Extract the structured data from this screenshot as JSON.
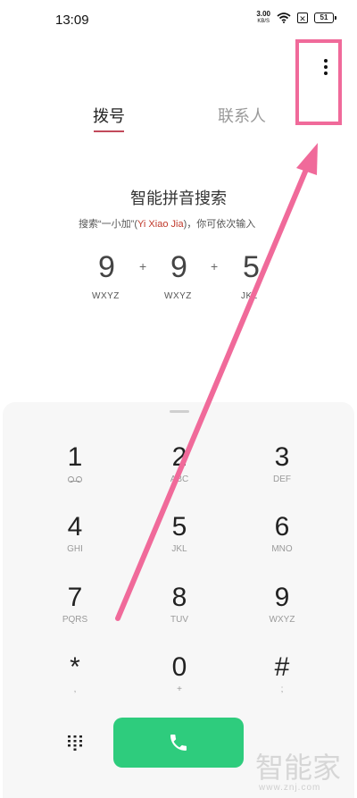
{
  "status_bar": {
    "time": "13:09",
    "net_speed_value": "3.00",
    "net_speed_unit": "KB/S",
    "sim_icon": "x-box-icon",
    "battery": "51"
  },
  "tabs": [
    {
      "label": "拨号",
      "active": true
    },
    {
      "label": "联系人",
      "active": false
    }
  ],
  "hint": {
    "title": "智能拼音搜索",
    "subtitle_prefix": "搜索“一小加”(",
    "subtitle_pinyin": "Yi Xiao Jia",
    "subtitle_suffix": ")，你可依次输入"
  },
  "demo": {
    "digits": [
      "9",
      "9",
      "5"
    ],
    "plus": "+",
    "letters": [
      "WXYZ",
      "WXYZ",
      "JKL"
    ]
  },
  "keypad": {
    "keys": [
      {
        "digit": "1",
        "letters": "",
        "icon": "voicemail-icon"
      },
      {
        "digit": "2",
        "letters": "ABC"
      },
      {
        "digit": "3",
        "letters": "DEF"
      },
      {
        "digit": "4",
        "letters": "GHI"
      },
      {
        "digit": "5",
        "letters": "JKL"
      },
      {
        "digit": "6",
        "letters": "MNO"
      },
      {
        "digit": "7",
        "letters": "PQRS"
      },
      {
        "digit": "8",
        "letters": "TUV"
      },
      {
        "digit": "9",
        "letters": "WXYZ"
      },
      {
        "digit": "*",
        "letters": ","
      },
      {
        "digit": "0",
        "letters": "+"
      },
      {
        "digit": "#",
        "letters": ";"
      }
    ]
  },
  "watermark": {
    "text": "www.znj.com",
    "logo": "智能家"
  },
  "colors": {
    "accent_underline": "#c24a5b",
    "call_button": "#2ecc7d",
    "annotation": "#f06a9a"
  }
}
